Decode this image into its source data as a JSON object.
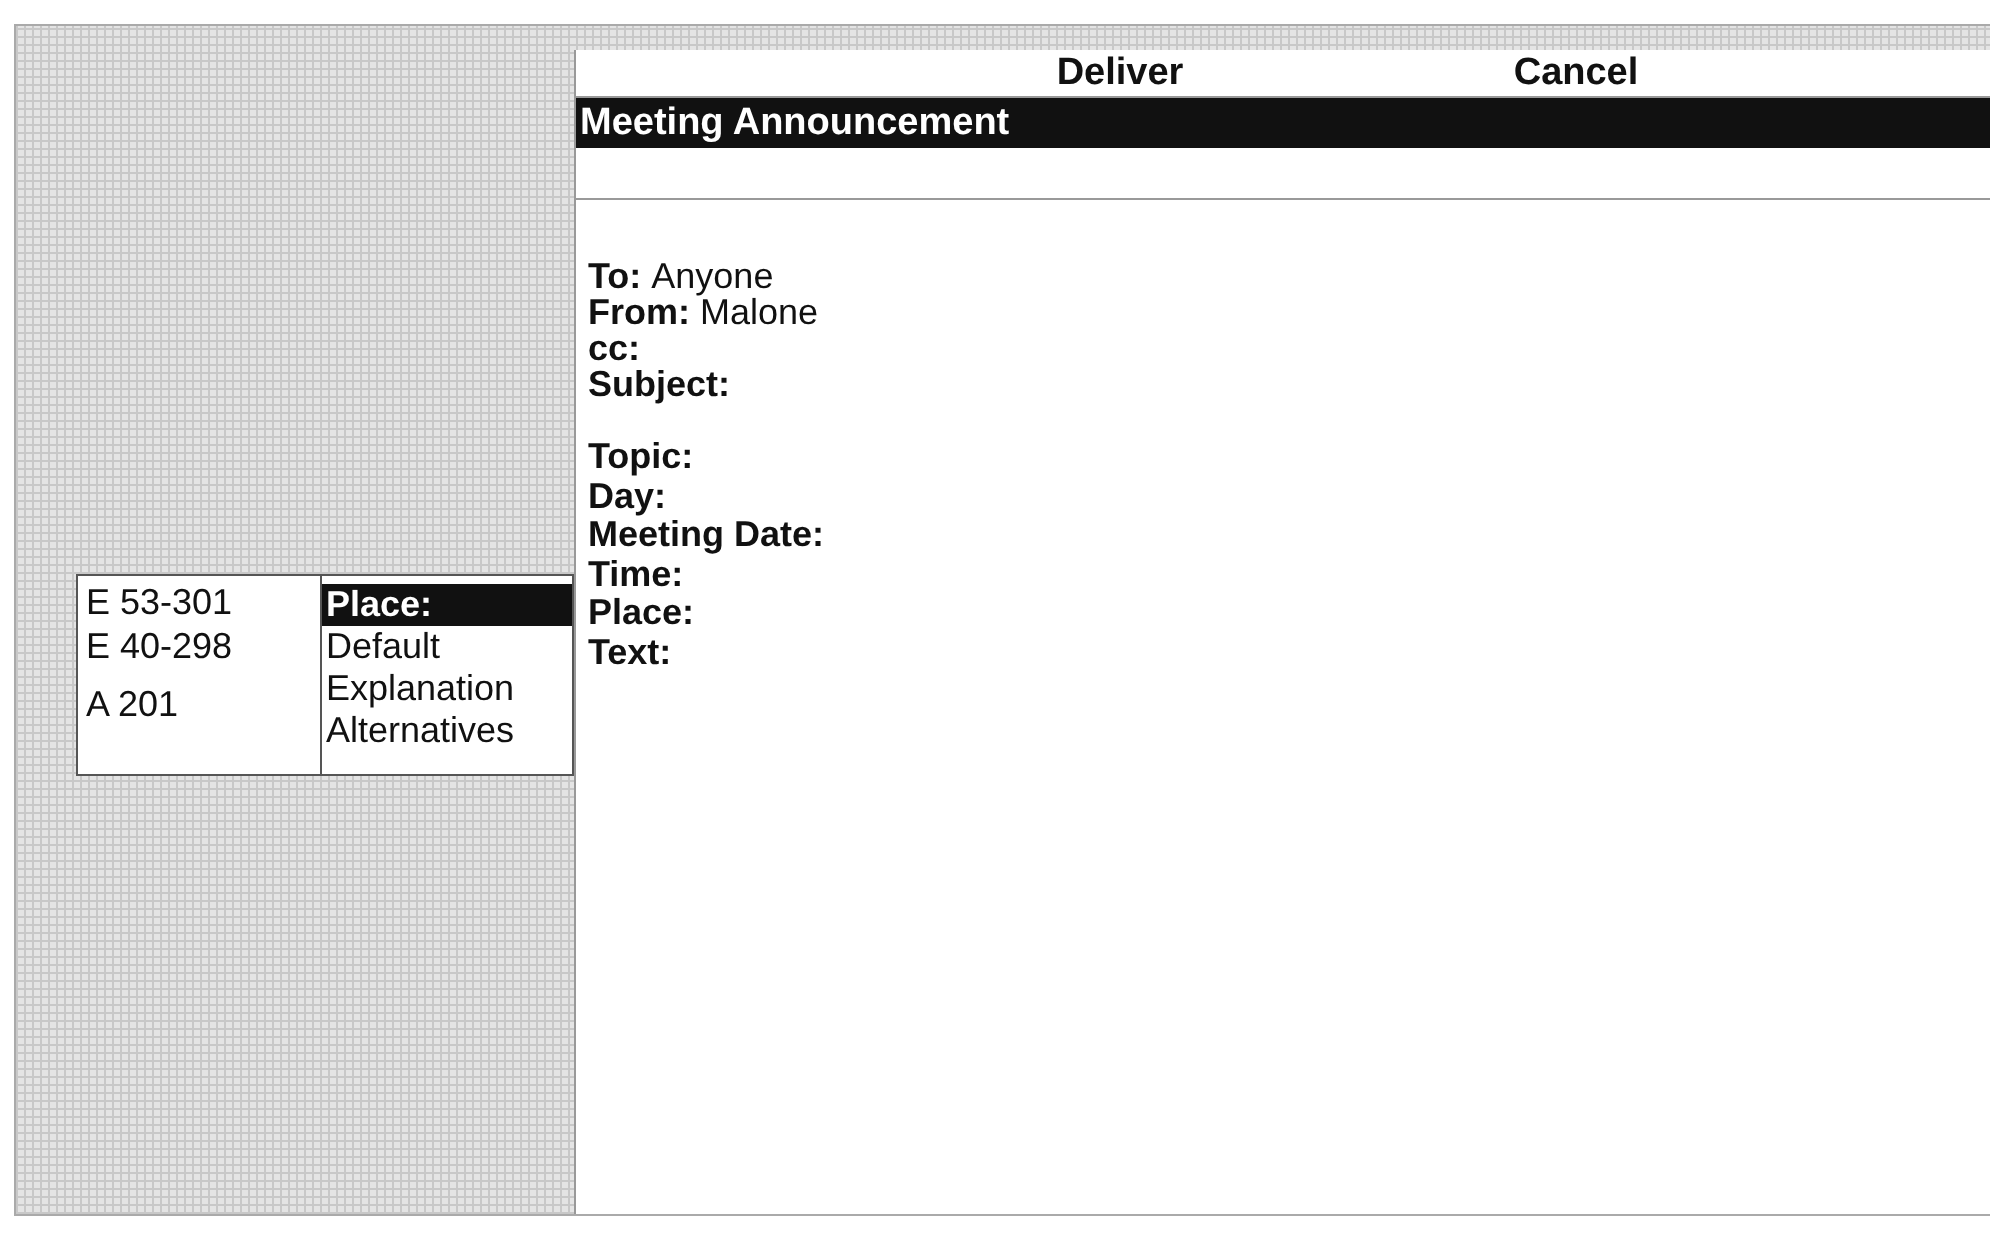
{
  "commands": [
    {
      "label": "Deliver"
    },
    {
      "label": "Cancel"
    }
  ],
  "window": {
    "title": "Meeting Announcement"
  },
  "header_fields": [
    {
      "label": "To:",
      "value": "Anyone"
    },
    {
      "label": "From:",
      "value": "Malone"
    },
    {
      "label": "cc:"
    },
    {
      "label": "Subject:"
    }
  ],
  "meeting_fields": [
    {
      "label": "Topic:"
    },
    {
      "label": "Day:"
    },
    {
      "label": "Meeting Date:"
    },
    {
      "label": "Time:"
    },
    {
      "label": "Place:"
    },
    {
      "label": "Text:"
    }
  ],
  "popup": {
    "values": [
      "E 53-301",
      "E 40-298",
      "A 201"
    ],
    "menu": [
      {
        "label": "Place:",
        "selected": true
      },
      {
        "label": "Default",
        "selected": false
      },
      {
        "label": "Explanation",
        "selected": false
      },
      {
        "label": "Alternatives",
        "selected": false
      }
    ]
  }
}
